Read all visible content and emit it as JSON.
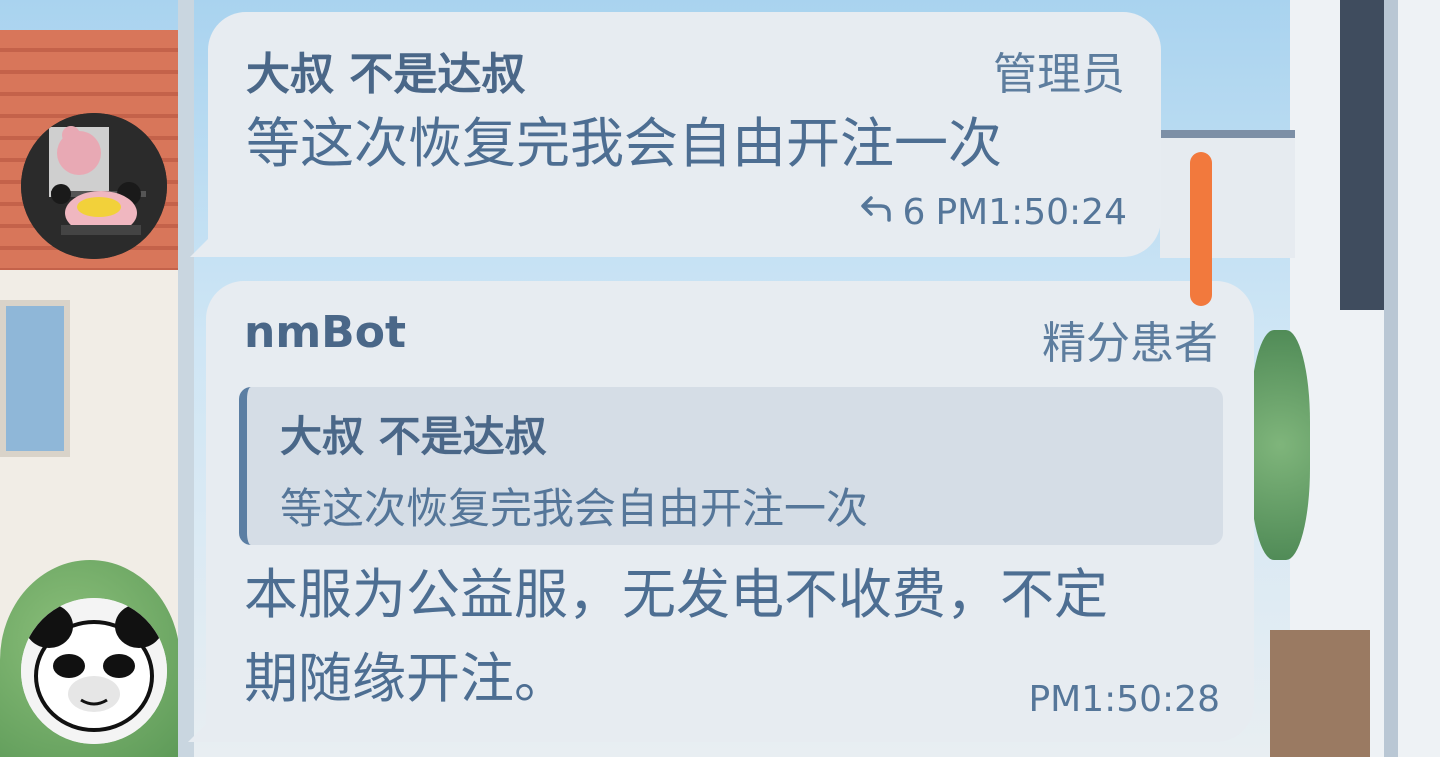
{
  "messages": [
    {
      "sender": "大叔 不是达叔",
      "role": "管理员",
      "text": "等这次恢复完我会自由开注一次",
      "reply_count": "6",
      "time": "PM1:50:24"
    },
    {
      "sender": "nmBot",
      "role": "精分患者",
      "quote_sender": "大叔 不是达叔",
      "quote_text": "等这次恢复完我会自由开注一次",
      "text_line1": "本服为公益服，无发电不收费，不定",
      "text_line2": "期随缘开注。",
      "time": "PM1:50:28"
    }
  ],
  "colors": {
    "bubble": "#e7ecf1",
    "text": "#48698d",
    "quote_bar": "#5b7ea3",
    "scroll_handle": "#f2793d"
  },
  "icons": {
    "reply": "reply-arrow-icon"
  }
}
